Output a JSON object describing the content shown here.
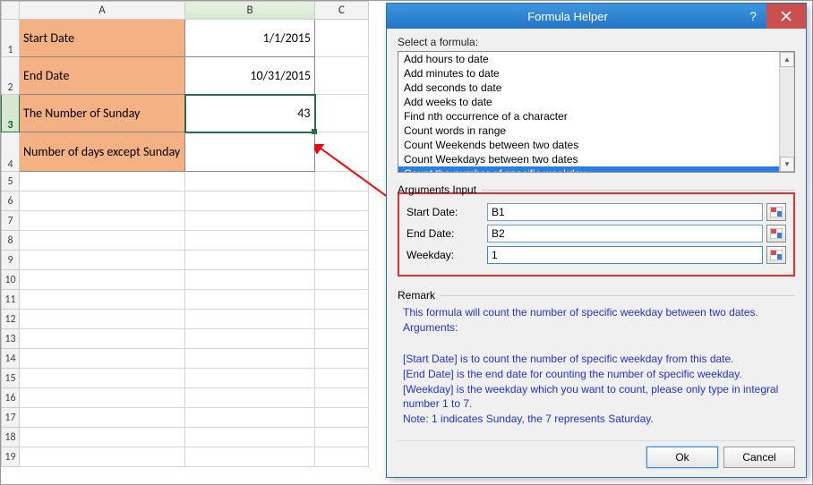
{
  "columns": [
    "A",
    "B",
    "C"
  ],
  "rows": {
    "r1": {
      "a": "Start Date",
      "b": "1/1/2015"
    },
    "r2": {
      "a": "End Date",
      "b": "10/31/2015"
    },
    "r3": {
      "a": "The Number of Sunday",
      "b": "43"
    },
    "r4": {
      "a": "Number of days except Sunday",
      "b": ""
    }
  },
  "row_numbers": [
    "1",
    "2",
    "3",
    "4",
    "5",
    "6",
    "7",
    "8",
    "9",
    "10",
    "11",
    "12",
    "13",
    "14",
    "15",
    "16",
    "17",
    "18",
    "19"
  ],
  "dialog": {
    "title": "Formula Helper",
    "select_label": "Select a formula:",
    "formulas": [
      "Add hours to date",
      "Add minutes to date",
      "Add seconds to date",
      "Add weeks to date",
      "Find nth occurrence of a character",
      "Count words in range",
      "Count Weekends between two dates",
      "Count Weekdays between two dates",
      "Count the number of specific weekday"
    ],
    "selected_formula_index": 8,
    "args_label": "Arguments Input",
    "args": {
      "start_label": "Start Date:",
      "start_value": "B1",
      "end_label": "End Date:",
      "end_value": "B2",
      "weekday_label": "Weekday:",
      "weekday_value": "1"
    },
    "remark_label": "Remark",
    "remark_lines": [
      "This formula will count the number of specific weekday between two dates.",
      "Arguments:",
      "",
      "[Start Date] is to count the number of specific weekday from this date.",
      "[End Date] is the end date for counting the number of specific weekday.",
      "[Weekday] is the weekday which you want to count, please only type in integral number 1 to 7.",
      "Note: 1 indicates Sunday, the 7 represents Saturday."
    ],
    "ok_label": "Ok",
    "cancel_label": "Cancel"
  }
}
